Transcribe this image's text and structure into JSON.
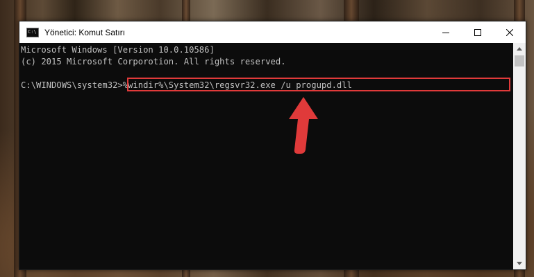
{
  "window": {
    "title": "Yönetici: Komut Satırı",
    "icon": "cmd-icon",
    "icon_glyph": "C:\\",
    "controls": [
      "minimize-icon",
      "maximize-icon",
      "close-icon"
    ]
  },
  "console": {
    "lines": [
      "Microsoft Windows [Version 10.0.10586]",
      "(c) 2015 Microsoft Corporotion. All rights reserved.",
      "",
      "C:\\WINDOWS\\system32>%windir%\\System32\\regsvr32.exe /u progupd.dll"
    ],
    "prompt": "C:\\WINDOWS\\system32>",
    "command": "%windir%\\System32\\regsvr32.exe /u progupd.dll"
  },
  "annotation": {
    "highlight_color": "#e03a3a",
    "arrow_color": "#e03a3a"
  }
}
